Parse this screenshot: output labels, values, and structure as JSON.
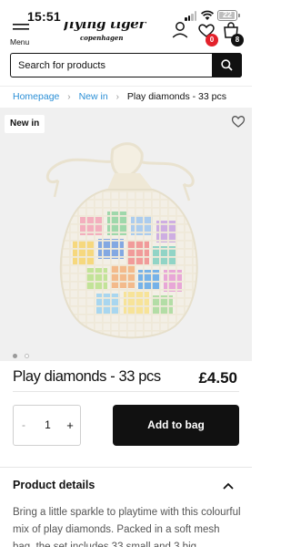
{
  "status": {
    "time": "15:51",
    "battery": "22"
  },
  "header": {
    "menu_label": "Menu",
    "logo_line1": "flying tiger",
    "logo_line2": "copenhagen",
    "favourites_count": "0",
    "bag_count": "8"
  },
  "search": {
    "placeholder": "Search for products"
  },
  "breadcrumb": [
    {
      "label": "Homepage"
    },
    {
      "label": "New in"
    },
    {
      "label": "Play diamonds - 33 pcs"
    }
  ],
  "product": {
    "badge": "New in",
    "title": "Play diamonds - 33 pcs",
    "price": "£4.50",
    "image_count": 2,
    "active_image": 1,
    "quantity": "1",
    "minus_label": "-",
    "plus_label": "+",
    "add_to_bag_label": "Add to bag"
  },
  "details": {
    "title": "Product details",
    "text": "Bring a little sparkle to playtime with this colourful mix of play diamonds. Packed in a soft mesh bag, the set includes 33 small and 3 big"
  },
  "colors": {
    "accent_link": "#2b8fd6",
    "badge_red": "#e3212b",
    "button_black": "#111111"
  }
}
